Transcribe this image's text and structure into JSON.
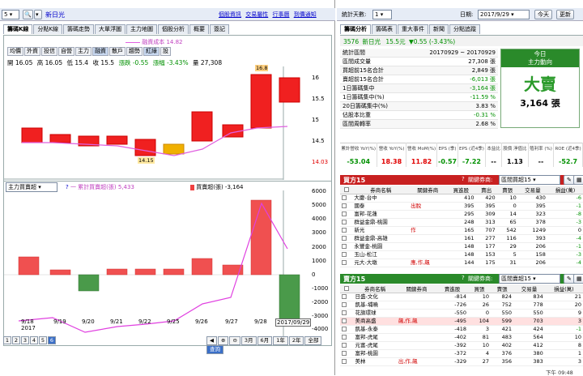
{
  "left_header": {
    "stock_code": "5",
    "stock_name": "新日光",
    "links": [
      "個股資訊",
      "交易屬性",
      "行事曆",
      "到價通知"
    ]
  },
  "left_tabs": [
    "籌碼K線",
    "分點K線",
    "籌碼走勢",
    "大單浮圖",
    "主力地圖",
    "個股分析",
    "概要",
    "簽記"
  ],
  "cost_line_label": "融資成本 14.82",
  "chart_toolbar": [
    "均價",
    "外資",
    "投信",
    "自營",
    "主力",
    "融資",
    "散戶",
    "趨勢",
    "紅綠",
    "設"
  ],
  "quote": {
    "open": "開 16.05",
    "high": "高 16.05",
    "low": "低 15.4",
    "close": "收 15.5",
    "change": "漲跌 -0.55",
    "pct": "漲幅 -3.43%",
    "volume": "量 27,308"
  },
  "price_axis": [
    "16",
    "15.5",
    "15",
    "14.5",
    "14.03"
  ],
  "price_labels": {
    "high": "16.8",
    "low": "14.15"
  },
  "lower_chart": {
    "select": "主力買賣超",
    "legend1": "一 累計買賣超(張) 5,433",
    "legend2": "買賣超(張) -3,164",
    "y_axis": [
      "6000",
      "5000",
      "4000",
      "3000",
      "2000",
      "1000",
      "0",
      "-1000",
      "-2000",
      "-3000",
      "-4000"
    ],
    "x_axis": [
      "9/18",
      "9/19",
      "9/20",
      "9/21",
      "9/22",
      "9/25",
      "9/26",
      "9/27",
      "9/28",
      "2017/09/29"
    ],
    "year": "2017"
  },
  "pager": [
    "1",
    "2",
    "3",
    "4",
    "5",
    "6"
  ],
  "range_buttons": [
    "3月",
    "6月",
    "1年",
    "2年",
    "全部",
    "查詢"
  ],
  "right_header": {
    "days_label": "統計天數:",
    "days_value": "1",
    "date_label": "日期:",
    "date_value": "2017/9/29",
    "today": "今天",
    "refresh": "更新"
  },
  "right_tabs": [
    "籌碼分析",
    "籌碼表",
    "重大事件",
    "新聞",
    "分點追蹤"
  ],
  "stock_line": {
    "code": "3576",
    "name": "新日光",
    "price": "15.5元",
    "change": "▼0.55 (-3.43%)"
  },
  "stats": [
    {
      "label": "統計區間",
      "value": "20170929 ~ 20170929"
    },
    {
      "label": "區間成交量",
      "value": "27,308 張"
    },
    {
      "label": "買超前15名合計",
      "value": "2,849 張"
    },
    {
      "label": "賣超前15名合計",
      "value": "-6,013 張"
    },
    {
      "label": "1日籌碼集中",
      "value": "-3,164 張"
    },
    {
      "label": "1日籌碼集中(%)",
      "value": "-11.59 %"
    },
    {
      "label": "20日籌碼集中(%)",
      "value": "3.83 %"
    },
    {
      "label": "佔股本比重",
      "value": "-0.31 %"
    },
    {
      "label": "區間周轉率",
      "value": "2.68 %"
    }
  ],
  "signal": {
    "title": "今日",
    "subtitle": "主力動向",
    "verdict": "大賣",
    "amount": "3,164 張"
  },
  "fundamentals": {
    "headers": [
      "累計營收 YoY(%)",
      "營收 YoY(%)",
      "營收 MoM(%)",
      "EPS (季)",
      "EPS (近4季)",
      "本益比",
      "股價 淨值比",
      "殖利率 (%)",
      "ROE (近4季)"
    ],
    "values": [
      "-53.04",
      "18.38",
      "11.82",
      "-0.57",
      "-7.22",
      "--",
      "1.13",
      "--",
      "-52.7"
    ]
  },
  "buy_table": {
    "title": "買方15",
    "filter_label": "關鍵券商:",
    "filter_value": "區間買超15",
    "headers": [
      "券商名稱",
      "關鍵券商",
      "買進股",
      "賣出",
      "賣張",
      "交易量",
      "損益(萬)"
    ],
    "rows": [
      [
        "大慶-台中",
        "",
        "410",
        "420",
        "10",
        "430",
        "-6"
      ],
      [
        "國泰",
        "出脫",
        "395",
        "395",
        "0",
        "395",
        "-1"
      ],
      [
        "富邦-花蓮",
        "",
        "295",
        "309",
        "14",
        "323",
        "-8"
      ],
      [
        "群益金鼎-桃園",
        "",
        "248",
        "313",
        "65",
        "378",
        "-3"
      ],
      [
        "新光",
        "作",
        "165",
        "707",
        "542",
        "1249",
        "0"
      ],
      [
        "群益金鼎-高雄",
        "",
        "161",
        "277",
        "116",
        "393",
        "-4"
      ],
      [
        "永豐金-桃園",
        "",
        "148",
        "177",
        "29",
        "206",
        "-1"
      ],
      [
        "玉山-松江",
        "",
        "148",
        "153",
        "5",
        "158",
        "-3"
      ],
      [
        "元大-大墩",
        "應,作,飆",
        "144",
        "175",
        "31",
        "206",
        "-4"
      ]
    ]
  },
  "sell_table": {
    "title": "賣方15",
    "filter_label": "關鍵券商:",
    "filter_value": "區間賣超15",
    "headers": [
      "券商名稱",
      "關鍵券商",
      "賣進股",
      "買張",
      "賣張",
      "交易量",
      "損益(萬)"
    ],
    "rows": [
      [
        "日盛-文化",
        "",
        "-814",
        "10",
        "824",
        "834",
        "21"
      ],
      [
        "凱基-埔曉",
        "",
        "-726",
        "26",
        "752",
        "778",
        "20"
      ],
      [
        "花旗環球",
        "",
        "-550",
        "0",
        "550",
        "550",
        "9"
      ],
      [
        "美商高盛",
        "飆,作,飆",
        "-495",
        "104",
        "599",
        "703",
        "3"
      ],
      [
        "凱基-永泰",
        "",
        "-418",
        "3",
        "421",
        "424",
        "-1"
      ],
      [
        "富邦-虎尾",
        "",
        "-402",
        "81",
        "483",
        "564",
        "10"
      ],
      [
        "元富-虎尾",
        "",
        "-392",
        "10",
        "402",
        "412",
        "8"
      ],
      [
        "富邦-桃園",
        "",
        "-372",
        "4",
        "376",
        "380",
        "1"
      ],
      [
        "美林",
        "出,作,飆",
        "-329",
        "27",
        "356",
        "383",
        "3"
      ]
    ]
  },
  "clock": "下午 09:48"
}
